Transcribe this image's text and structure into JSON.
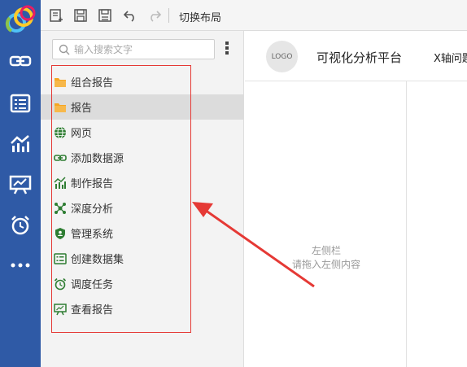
{
  "toolbar": {
    "layout_label": "切换布局",
    "buttons": [
      "new-report-icon",
      "save-icon",
      "save-as-icon",
      "undo-icon",
      "redo-icon"
    ]
  },
  "sidebar_nav": [
    "link-icon",
    "list-icon",
    "chart-icon",
    "presentation-icon",
    "alarm-icon",
    "more-icon"
  ],
  "search": {
    "placeholder": "输入搜索文字"
  },
  "tree": {
    "items": [
      {
        "label": "组合报告",
        "icon": "folder-icon"
      },
      {
        "label": "报告",
        "icon": "folder-icon"
      },
      {
        "label": "网页",
        "icon": "globe-icon"
      },
      {
        "label": "添加数据源",
        "icon": "link-icon"
      },
      {
        "label": "制作报告",
        "icon": "chart-icon"
      },
      {
        "label": "深度分析",
        "icon": "network-icon"
      },
      {
        "label": "管理系统",
        "icon": "shield-icon"
      },
      {
        "label": "创建数据集",
        "icon": "list-icon"
      },
      {
        "label": "调度任务",
        "icon": "alarm-icon"
      },
      {
        "label": "查看报告",
        "icon": "presentation-icon"
      }
    ],
    "selected_index": 1
  },
  "main": {
    "logo_text": "LOGO",
    "title": "可视化分析平台",
    "axis_label": "X轴问题",
    "placeholder_line1": "左侧栏",
    "placeholder_line2": "请拖入左侧内容"
  },
  "colors": {
    "sidebar": "#2f5aa6",
    "icon_green": "#2e7d32",
    "folder": "#f5a623",
    "highlight": "#e53935"
  }
}
